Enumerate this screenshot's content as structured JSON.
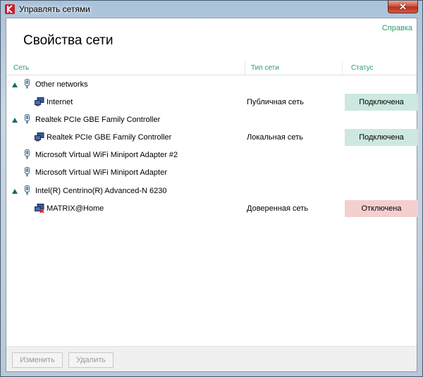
{
  "window": {
    "title": "Управлять сетями",
    "close_label": "✕"
  },
  "header": {
    "help_link": "Справка",
    "page_title": "Свойства сети"
  },
  "table": {
    "columns": {
      "network": "Сеть",
      "type": "Тип сети",
      "status": "Статус"
    },
    "rows": [
      {
        "kind": "adapter",
        "name": "Other networks"
      },
      {
        "kind": "network",
        "name": "Internet",
        "type": "Публичная сеть",
        "status": "Подключена",
        "status_color": "#cde8e0",
        "icon": "network-icon"
      },
      {
        "kind": "adapter",
        "name": "Realtek PCIe GBE Family Controller"
      },
      {
        "kind": "network",
        "name": "Realtek PCIe GBE Family Controller",
        "type": "Локальная сеть",
        "status": "Подключена",
        "status_color": "#cde8e0",
        "icon": "network-icon"
      },
      {
        "kind": "adapter",
        "name": "Microsoft Virtual WiFi Miniport Adapter #2"
      },
      {
        "kind": "adapter",
        "name": "Microsoft Virtual WiFi Miniport Adapter"
      },
      {
        "kind": "adapter",
        "name": "Intel(R) Centrino(R) Advanced-N 6230"
      },
      {
        "kind": "network",
        "name": "MATRIX@Home",
        "type": "Доверенная сеть",
        "status": "Отключена",
        "status_color": "#f5cfd0",
        "icon": "network-disconnected-icon"
      }
    ]
  },
  "footer": {
    "edit_button": "Изменить",
    "delete_button": "Удалить"
  },
  "colors": {
    "accent": "#2a9a6a",
    "connected": "#cde8e0",
    "disconnected": "#f5cfd0"
  }
}
